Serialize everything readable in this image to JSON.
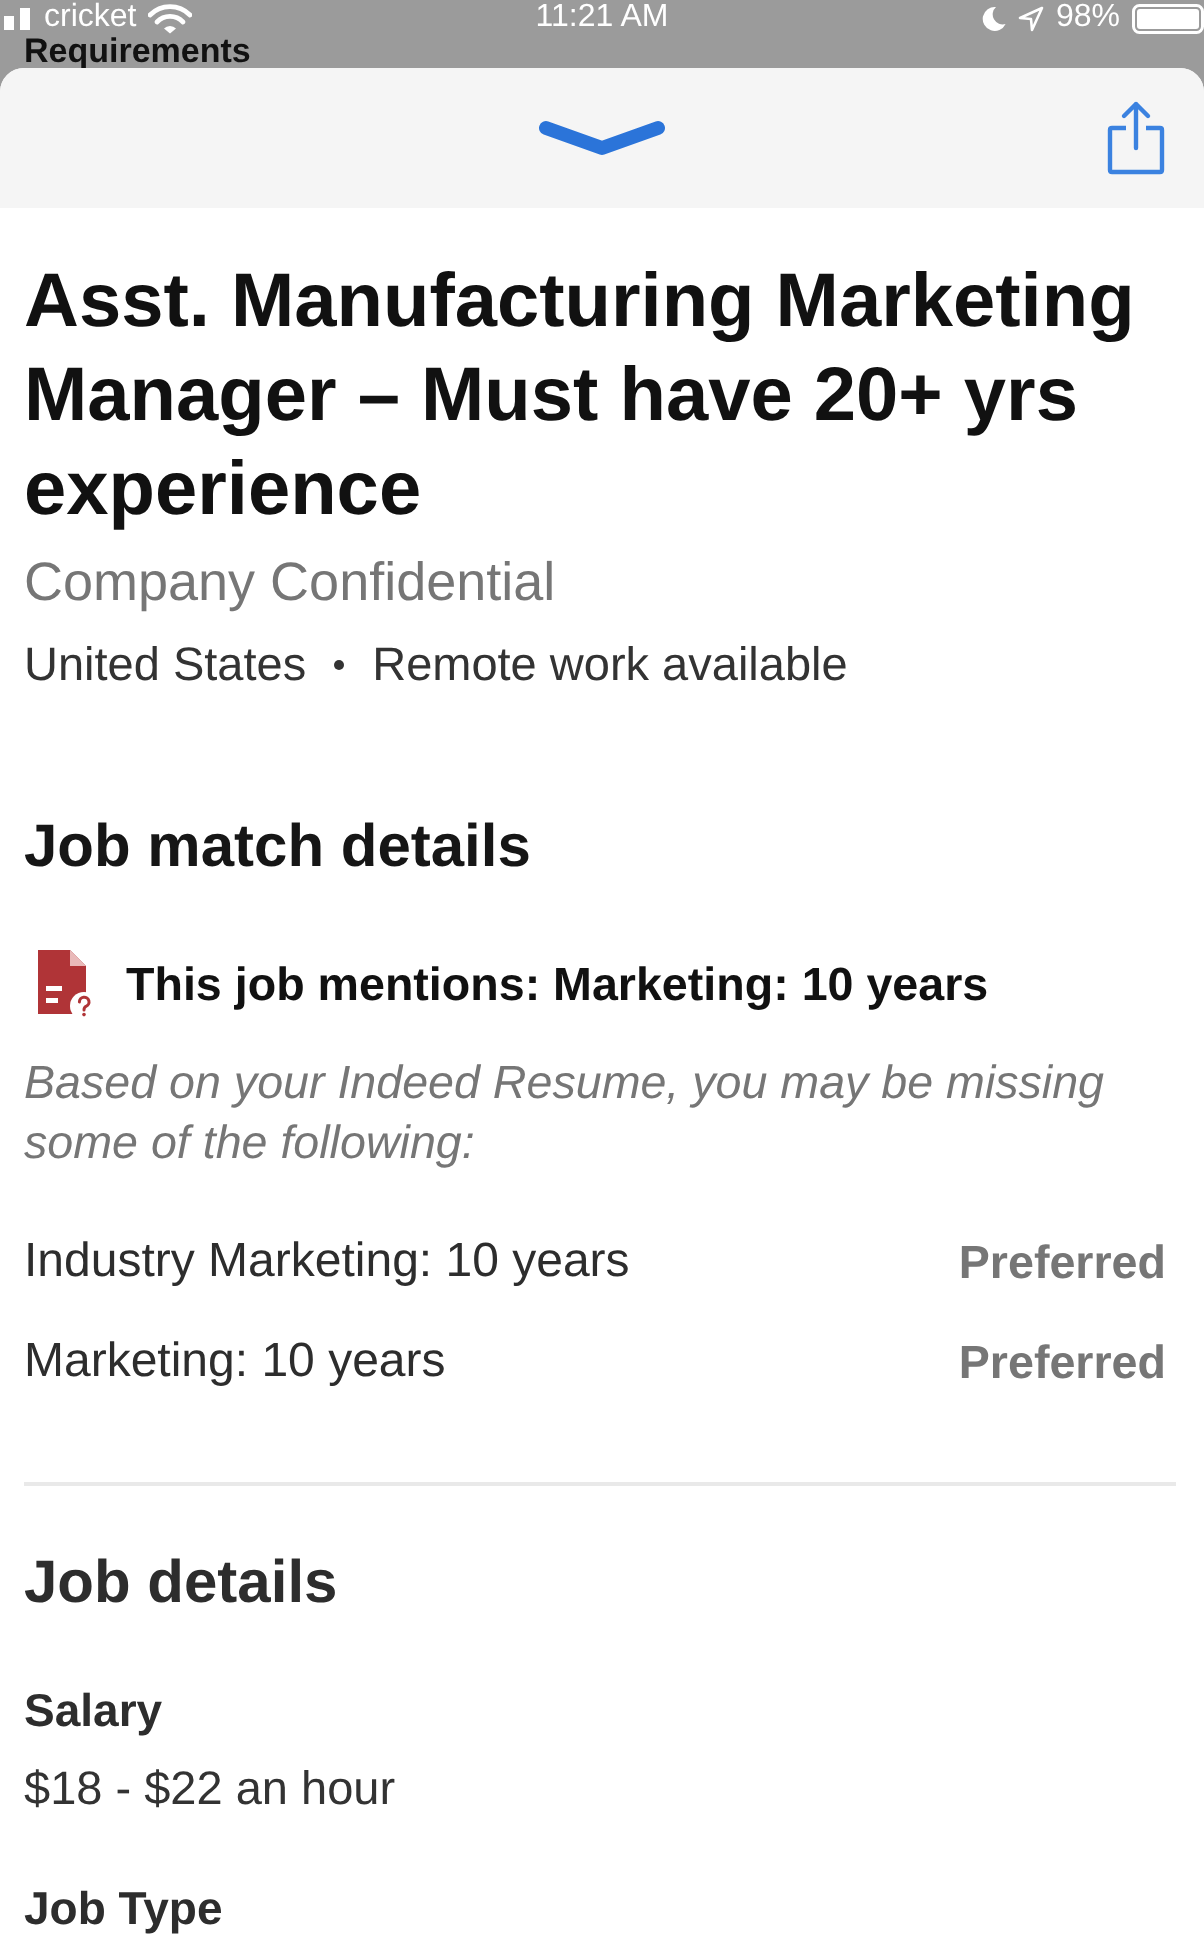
{
  "status_bar": {
    "carrier": "cricket",
    "time": "11:21 AM",
    "battery": "98%"
  },
  "page_behind": {
    "heading": "Requirements"
  },
  "job": {
    "title": "Asst. Manufacturing Marketing Manager – Must have 20+ yrs experience",
    "company": "Company Confidential",
    "location": "United States",
    "remote": "Remote work available"
  },
  "job_match": {
    "heading": "Job match details",
    "mention": "This job mentions: Marketing: 10 years",
    "note": "Based on your Indeed Resume, you may be missing some of the following:",
    "requirements": [
      {
        "label": "Industry Marketing: 10 years",
        "status": "Preferred"
      },
      {
        "label": "Marketing: 10 years",
        "status": "Preferred"
      }
    ]
  },
  "job_details": {
    "heading": "Job details",
    "sections": [
      {
        "label": "Salary",
        "value": "$18 - $22 an hour"
      },
      {
        "label": "Job Type"
      }
    ]
  }
}
